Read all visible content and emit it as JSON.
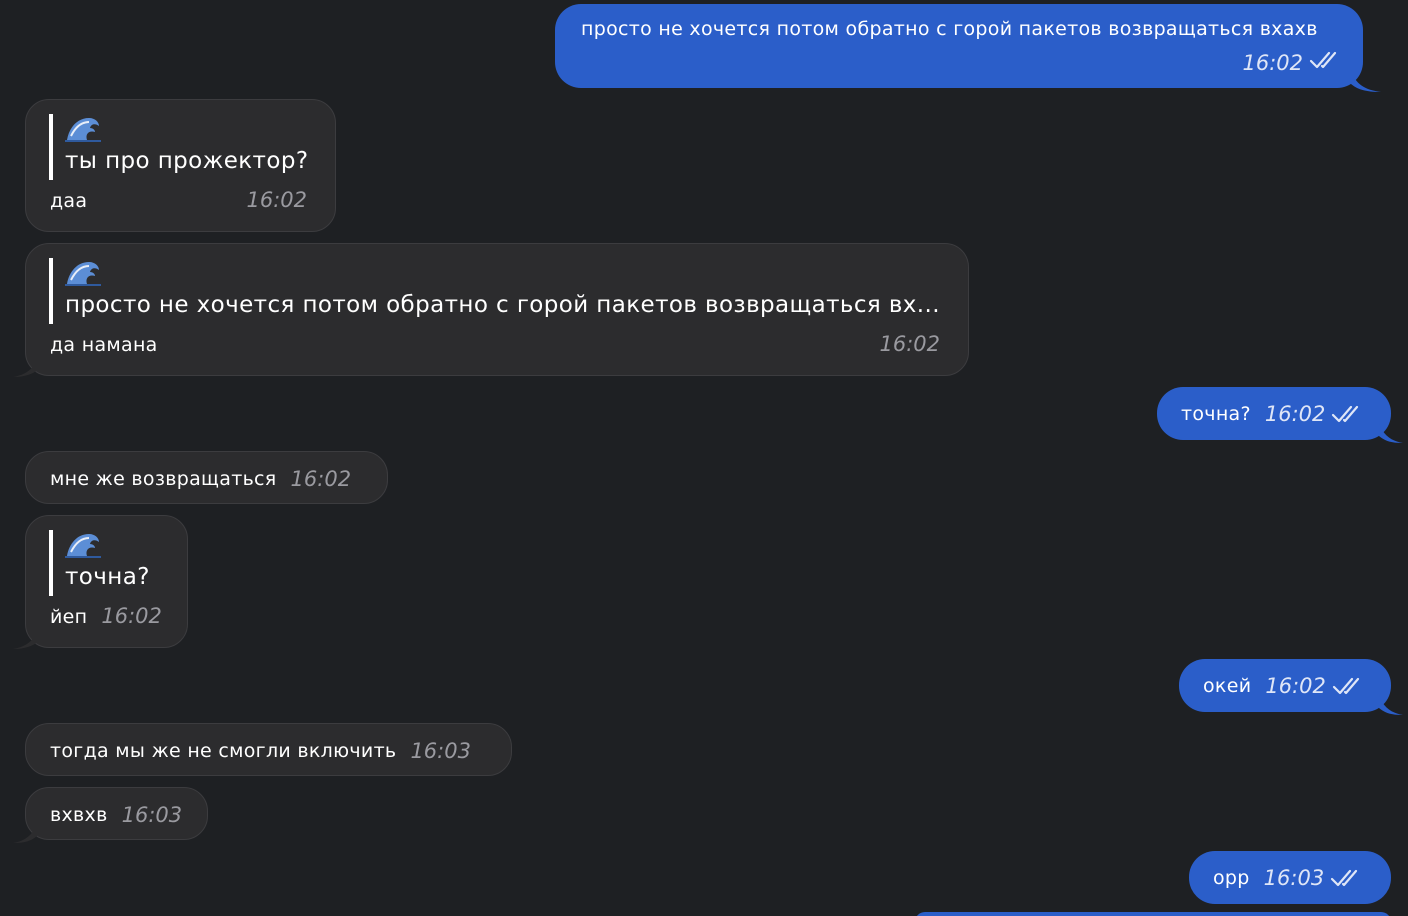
{
  "messages": [
    {
      "dir": "out",
      "text": "просто не хочется потом обратно с горой пакетов возвращаться вхахв",
      "time": "16:02"
    },
    {
      "dir": "in",
      "quote_emoji": "🌊",
      "quote_text": "ты про прожектор?",
      "text": "даа",
      "time": "16:02"
    },
    {
      "dir": "in",
      "quote_emoji": "🌊",
      "quote_text": "просто не хочется потом обратно с горой пакетов возвращаться вх...",
      "text": "да намана",
      "time": "16:02"
    },
    {
      "dir": "out",
      "text": "точна?",
      "time": "16:02"
    },
    {
      "dir": "in",
      "text": "мне же возвращаться",
      "time": "16:02"
    },
    {
      "dir": "in",
      "quote_emoji": "🌊",
      "quote_text": "точна?",
      "text": "йеп",
      "time": "16:02"
    },
    {
      "dir": "out",
      "text": "окей",
      "time": "16:02"
    },
    {
      "dir": "in",
      "text": "тогда мы же не смогли включить",
      "time": "16:03"
    },
    {
      "dir": "in",
      "text": "вхвхв",
      "time": "16:03"
    },
    {
      "dir": "out",
      "text": "орр",
      "time": "16:03"
    }
  ],
  "icons": {
    "read_receipt": "double-check-icon",
    "quote_emoji_icon": "wave-emoji-icon"
  },
  "colors": {
    "background": "#1e2023",
    "incoming_bubble": "#2c2c2e",
    "outgoing_bubble": "#2b5ec9"
  }
}
